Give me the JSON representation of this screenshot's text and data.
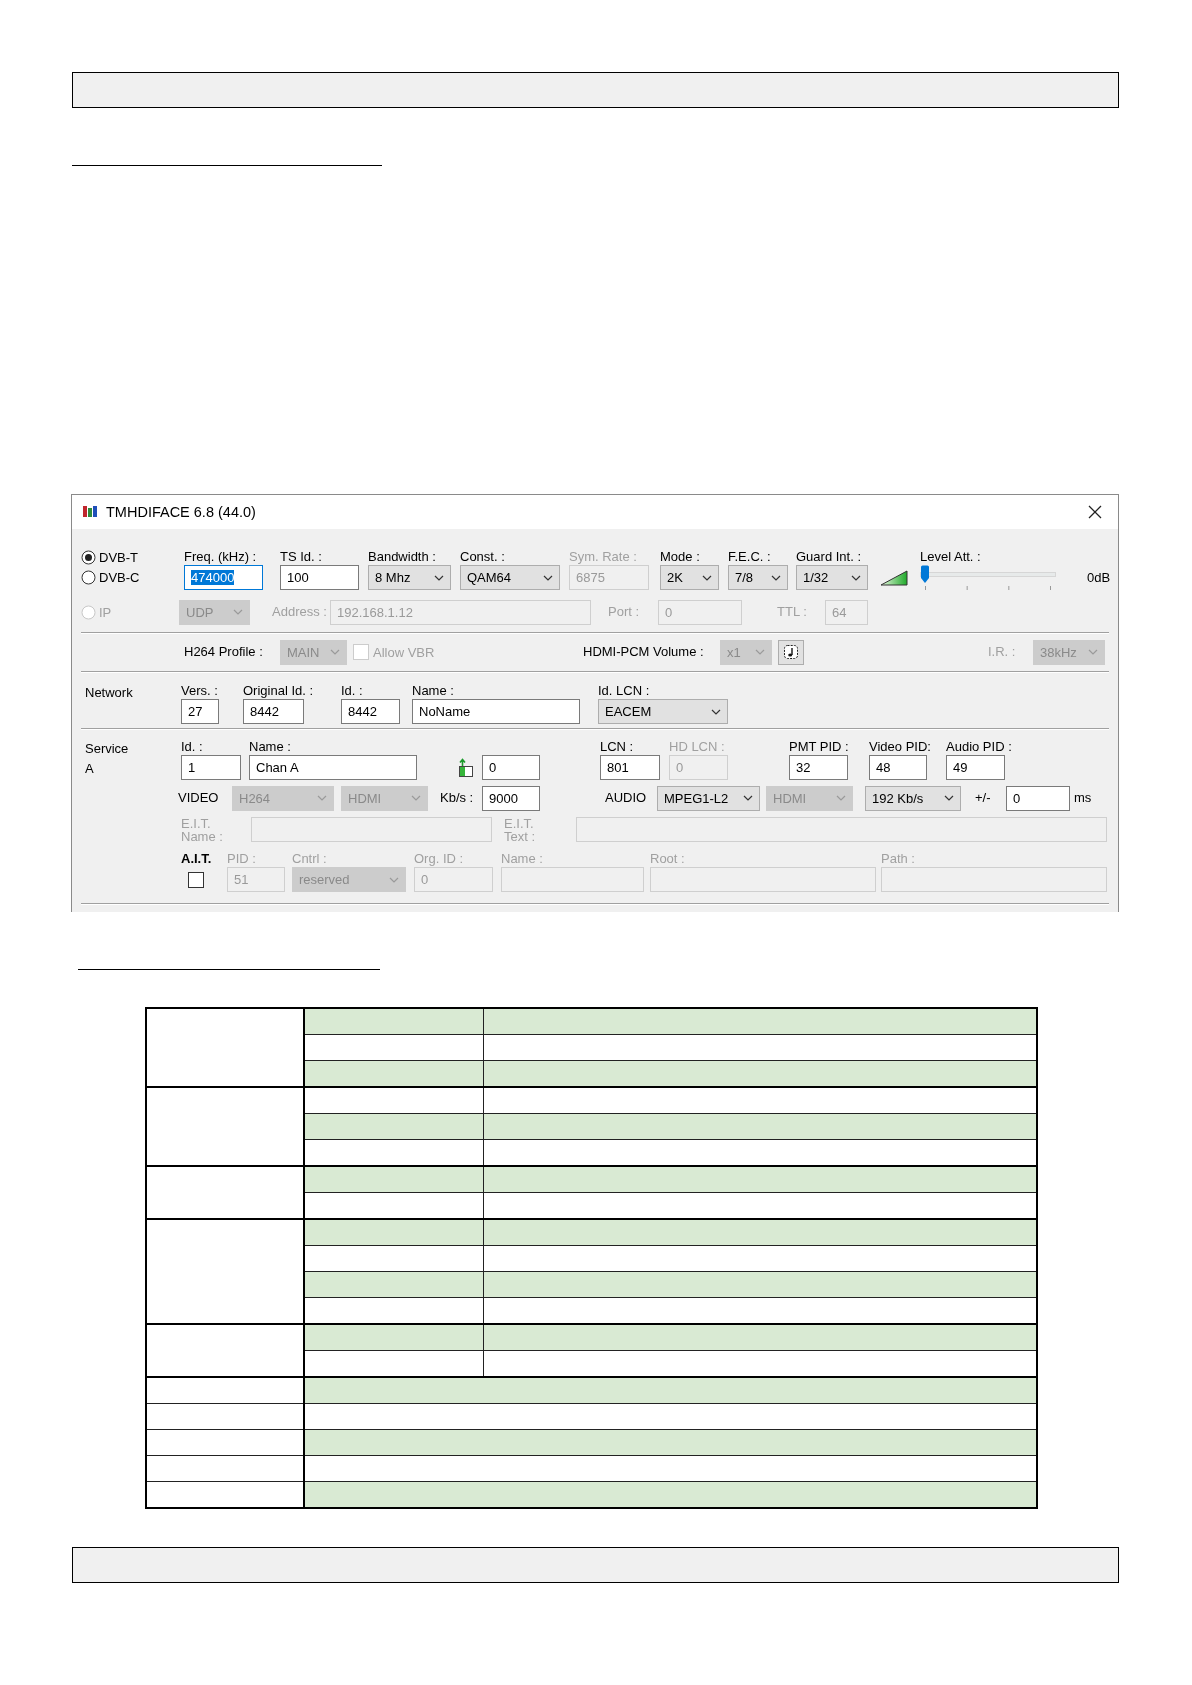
{
  "page": {
    "table": {
      "rows": [
        {
          "kind": "group",
          "sub_rows": [
            {
              "shaded": true
            },
            {
              "shaded": false
            },
            {
              "shaded": true
            }
          ]
        },
        {
          "kind": "group",
          "sub_rows": [
            {
              "shaded": false
            },
            {
              "shaded": true
            },
            {
              "shaded": false
            }
          ]
        },
        {
          "kind": "group",
          "sub_rows": [
            {
              "shaded": true
            },
            {
              "shaded": false
            }
          ]
        },
        {
          "kind": "group",
          "sub_rows": [
            {
              "shaded": true
            },
            {
              "shaded": false
            },
            {
              "shaded": true
            },
            {
              "shaded": false
            }
          ]
        },
        {
          "kind": "group",
          "sub_rows": [
            {
              "shaded": true
            },
            {
              "shaded": false
            }
          ]
        },
        {
          "kind": "single",
          "shaded": true
        },
        {
          "kind": "single",
          "shaded": false
        },
        {
          "kind": "single",
          "shaded": true
        },
        {
          "kind": "single",
          "shaded": false
        },
        {
          "kind": "single",
          "shaded": true
        }
      ]
    }
  },
  "dialog": {
    "title": "TMHDIFACE 6.8 (44.0)",
    "sections": [
      {
        "kind": "tuner",
        "standards": [
          {
            "label": "DVB-T",
            "selected": true,
            "disabled": false
          },
          {
            "label": "DVB-C",
            "selected": false,
            "disabled": false
          },
          {
            "label": "IP",
            "selected": false,
            "disabled": true
          }
        ],
        "lines": [
          {
            "controls": [
              {
                "kind": "text",
                "label": "Freq. (kHz) :",
                "value": "474000",
                "disabled": false,
                "focused": true
              },
              {
                "kind": "text",
                "label": "TS Id. :",
                "value": "100",
                "disabled": false,
                "focused": false
              },
              {
                "kind": "combo",
                "label": "Bandwidth :",
                "value": "8 Mhz",
                "disabled": false
              },
              {
                "kind": "combo",
                "label": "Const. :",
                "value": "QAM64",
                "disabled": false
              },
              {
                "kind": "text",
                "label": "Sym. Rate :",
                "value": "6875",
                "disabled": true,
                "focused": false
              },
              {
                "kind": "combo",
                "label": "Mode :",
                "value": "2K",
                "disabled": false
              },
              {
                "kind": "combo",
                "label": "F.E.C. :",
                "value": "7/8",
                "disabled": false
              },
              {
                "kind": "combo",
                "label": "Guard Int. :",
                "value": "1/32",
                "disabled": false
              },
              {
                "kind": "ramp_icon"
              },
              {
                "kind": "slider",
                "label": "Level Att. :",
                "level": 0
              },
              {
                "kind": "label",
                "text": "0dB",
                "disabled": false
              }
            ]
          },
          {
            "controls": [
              {
                "kind": "combo",
                "value": "UDP",
                "disabled": true
              },
              {
                "kind": "label",
                "text": "Address :",
                "disabled": true
              },
              {
                "kind": "text",
                "value": "192.168.1.12",
                "disabled": true,
                "focused": false
              },
              {
                "kind": "label",
                "text": "Port :",
                "disabled": true
              },
              {
                "kind": "text",
                "value": "0",
                "disabled": true,
                "focused": false
              },
              {
                "kind": "label",
                "text": "TTL :",
                "disabled": true
              },
              {
                "kind": "text",
                "value": "64",
                "disabled": true,
                "focused": false
              }
            ]
          }
        ]
      },
      {
        "kind": "options",
        "lines": [
          {
            "controls": [
              {
                "kind": "label",
                "text": "H264 Profile :",
                "disabled": false
              },
              {
                "kind": "combo",
                "value": "MAIN",
                "disabled": true
              },
              {
                "kind": "checkbox",
                "label": "Allow VBR",
                "checked": false,
                "disabled": true
              },
              {
                "kind": "label",
                "text": "HDMI-PCM Volume :",
                "disabled": false
              },
              {
                "kind": "combo",
                "value": "x1",
                "disabled": true
              },
              {
                "kind": "note_button"
              },
              {
                "kind": "label",
                "text": "I.R. :",
                "disabled": true
              },
              {
                "kind": "combo",
                "value": "38kHz",
                "disabled": true
              }
            ]
          }
        ]
      },
      {
        "kind": "network",
        "title": "Network",
        "lines": [
          {
            "controls": [
              {
                "kind": "text",
                "label": "Vers. :",
                "value": "27",
                "disabled": false,
                "focused": false
              },
              {
                "kind": "text",
                "label": "Original Id. :",
                "value": "8442",
                "disabled": false,
                "focused": false
              },
              {
                "kind": "text",
                "label": "Id. :",
                "value": "8442",
                "disabled": false,
                "focused": false
              },
              {
                "kind": "text",
                "label": "Name :",
                "value": "NoName",
                "disabled": false,
                "focused": false
              },
              {
                "kind": "combo",
                "label": "Id. LCN :",
                "value": "EACEM",
                "disabled": false
              }
            ]
          }
        ]
      },
      {
        "kind": "service",
        "title": "Service",
        "subtitle": "A",
        "lines": [
          {
            "controls": [
              {
                "kind": "text",
                "label": "Id. :",
                "value": "1",
                "disabled": false,
                "focused": false
              },
              {
                "kind": "text",
                "label": "Name :",
                "value": "Chan A",
                "disabled": false,
                "focused": false
              },
              {
                "kind": "insert_icon"
              },
              {
                "kind": "text",
                "value": "0",
                "disabled": false,
                "focused": false
              },
              {
                "kind": "text",
                "label": "LCN :",
                "value": "801",
                "disabled": false,
                "focused": false
              },
              {
                "kind": "text",
                "label": "HD LCN :",
                "value": "0",
                "disabled": true,
                "focused": false
              },
              {
                "kind": "text",
                "label": "PMT PID :",
                "value": "32",
                "disabled": false,
                "focused": false
              },
              {
                "kind": "text",
                "label": "Video PID:",
                "value": "48",
                "disabled": false,
                "focused": false
              },
              {
                "kind": "text",
                "label": "Audio PID :",
                "value": "49",
                "disabled": false,
                "focused": false
              }
            ]
          },
          {
            "controls": [
              {
                "kind": "label",
                "text": "VIDEO",
                "disabled": false
              },
              {
                "kind": "combo",
                "value": "H264",
                "disabled": true
              },
              {
                "kind": "combo",
                "value": "HDMI",
                "disabled": true
              },
              {
                "kind": "label",
                "text": "Kb/s :",
                "disabled": false
              },
              {
                "kind": "text",
                "value": "9000",
                "disabled": false,
                "focused": false
              },
              {
                "kind": "label",
                "text": "AUDIO",
                "disabled": false
              },
              {
                "kind": "combo",
                "value": "MPEG1-L2",
                "disabled": false
              },
              {
                "kind": "combo",
                "value": "HDMI",
                "disabled": true
              },
              {
                "kind": "combo",
                "value": "192 Kb/s",
                "disabled": false
              },
              {
                "kind": "label",
                "text": "+/-",
                "disabled": false
              },
              {
                "kind": "text",
                "value": "0",
                "disabled": false,
                "focused": false
              },
              {
                "kind": "label",
                "text": "ms",
                "disabled": false
              }
            ]
          },
          {
            "controls": [
              {
                "kind": "label",
                "text": "E.I.T. Name :",
                "disabled": true
              },
              {
                "kind": "text",
                "disabled": true,
                "focused": false
              },
              {
                "kind": "label",
                "text": "E.I.T. Text :",
                "disabled": true
              },
              {
                "kind": "text",
                "disabled": true,
                "focused": false
              }
            ]
          },
          {
            "controls": [
              {
                "kind": "checkbox",
                "label": "A.I.T.",
                "checked": false,
                "disabled": false
              },
              {
                "kind": "text",
                "label": "PID :",
                "value": "51",
                "disabled": true,
                "focused": false
              },
              {
                "kind": "combo",
                "label": "Cntrl :",
                "value": "reserved",
                "disabled": true
              },
              {
                "kind": "text",
                "label": "Org. ID :",
                "value": "0",
                "disabled": true,
                "focused": false
              },
              {
                "kind": "text",
                "label": "Name :",
                "disabled": true,
                "focused": false
              },
              {
                "kind": "text",
                "label": "Root :",
                "disabled": true,
                "focused": false
              },
              {
                "kind": "text",
                "label": "Path :",
                "disabled": true,
                "focused": false
              }
            ]
          }
        ]
      }
    ]
  }
}
